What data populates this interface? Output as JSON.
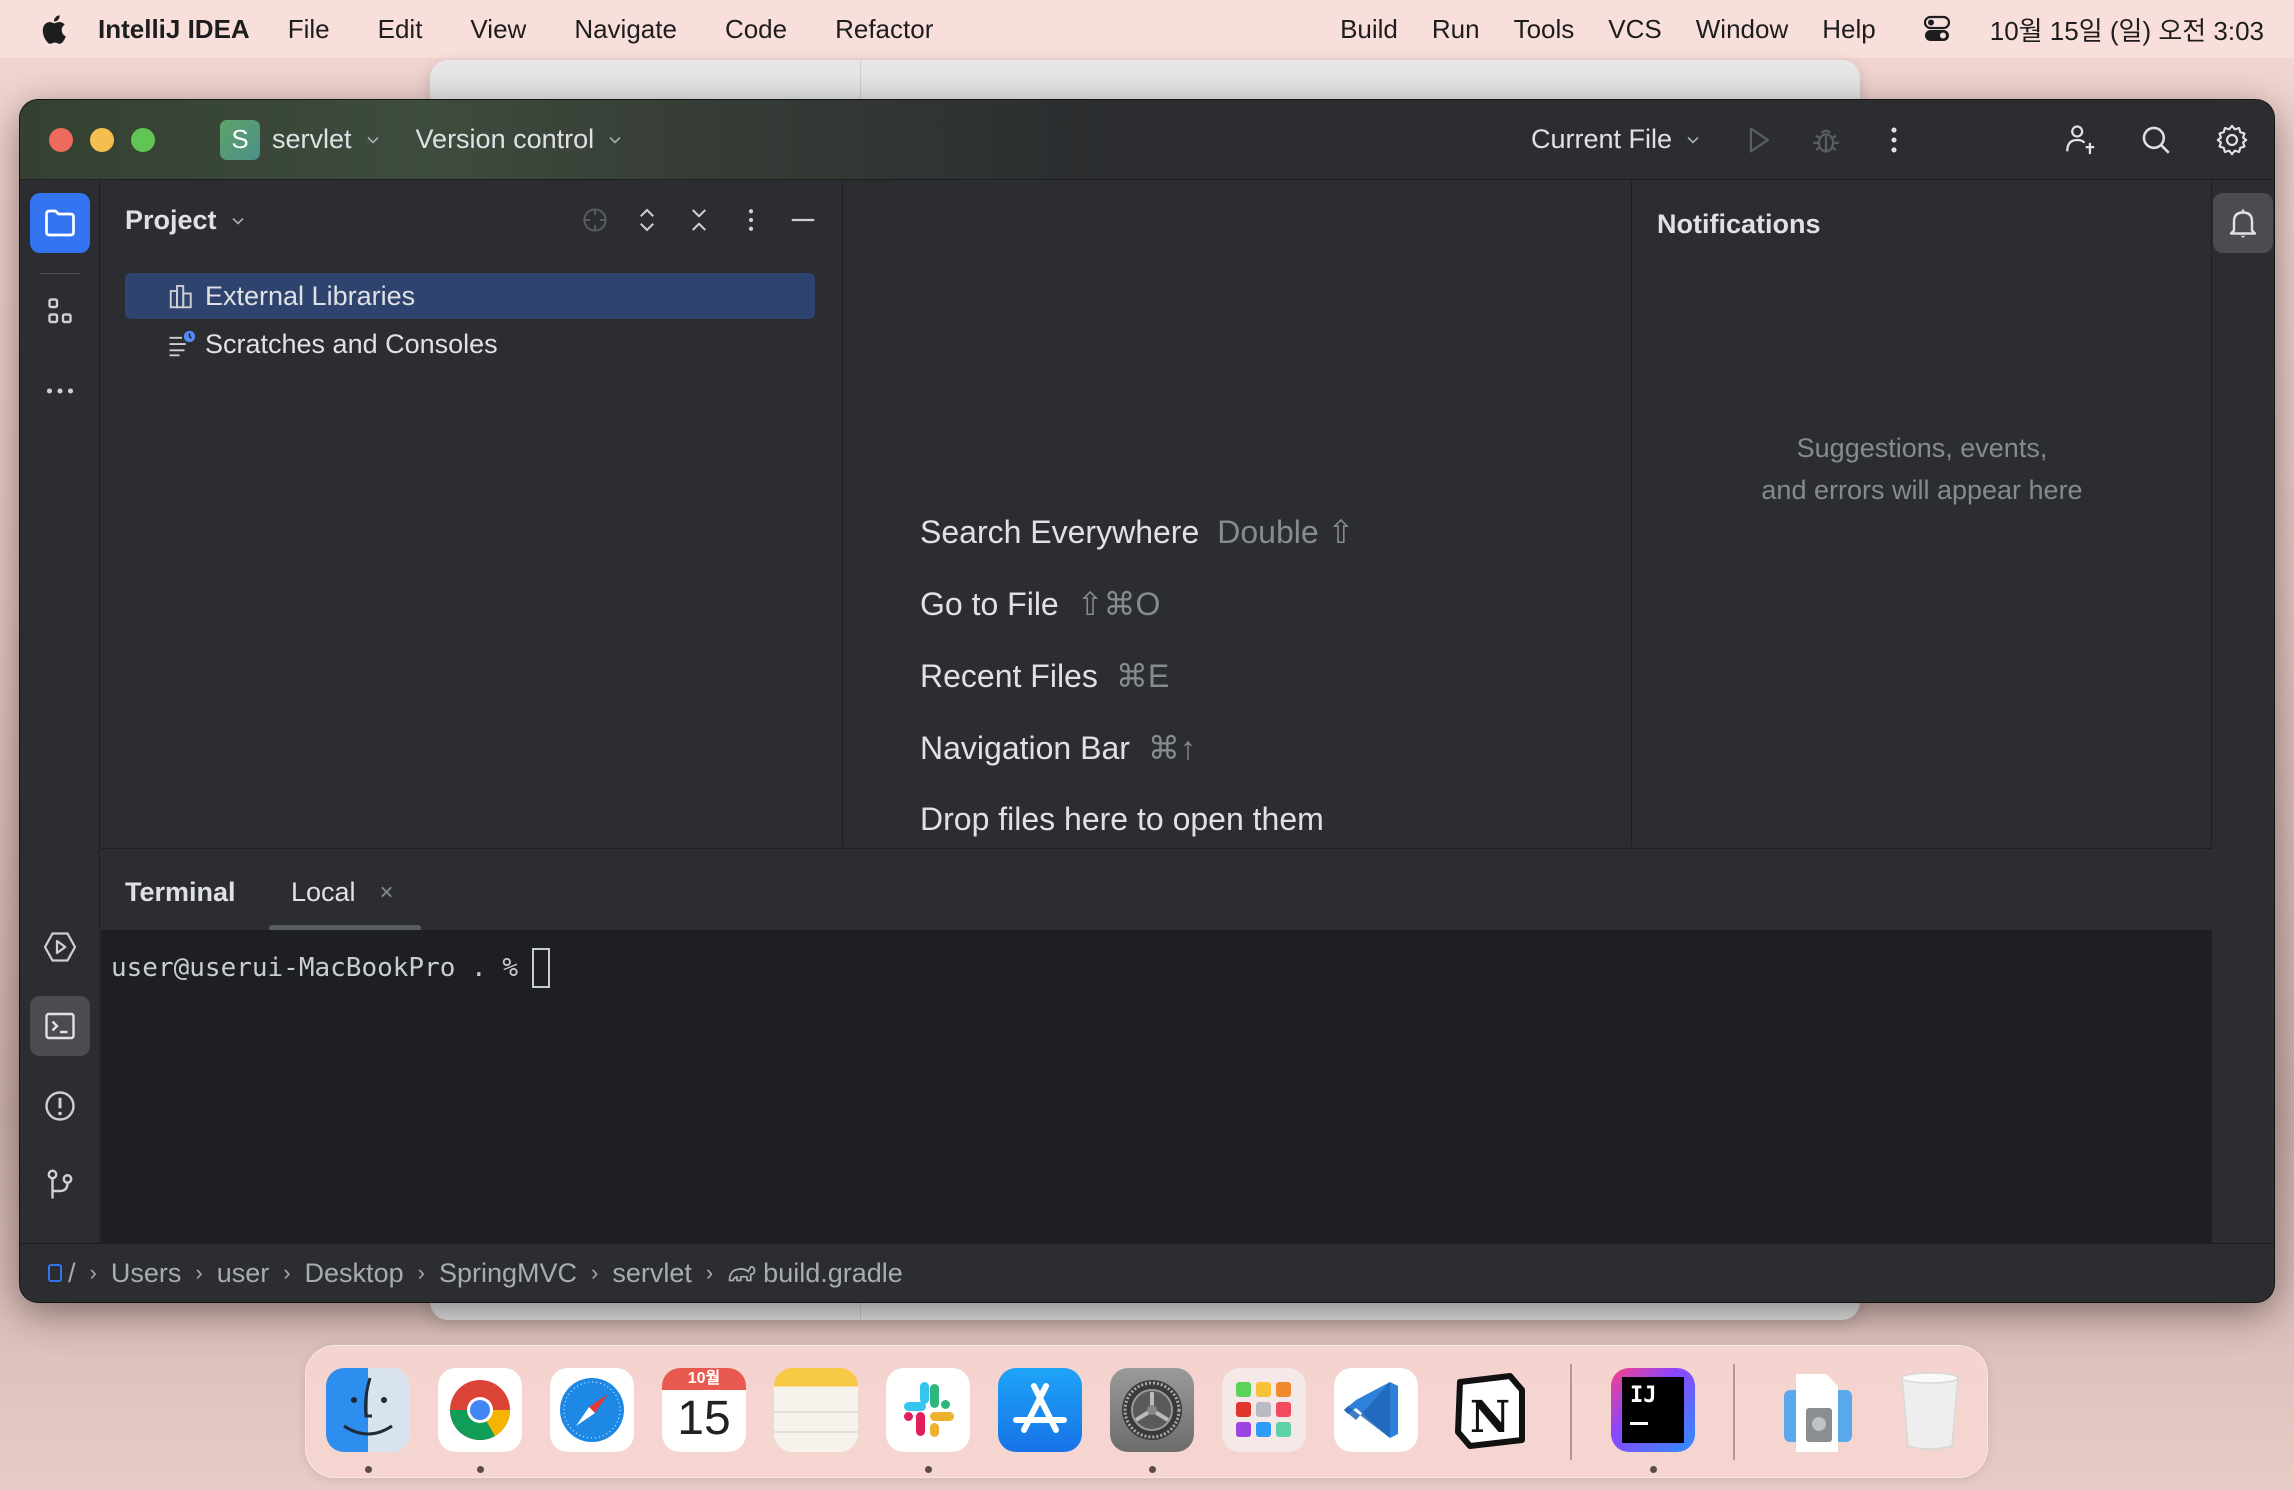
{
  "menubar": {
    "app_name": "IntelliJ IDEA",
    "items": [
      "File",
      "Edit",
      "View",
      "Navigate",
      "Code",
      "Refactor"
    ],
    "right_items": [
      "Build",
      "Run",
      "Tools",
      "VCS",
      "Window",
      "Help"
    ],
    "clock": "10월 15일 (일) 오전 3:03"
  },
  "titlebar": {
    "project_badge": "S",
    "project_name": "servlet",
    "vcs_label": "Version control",
    "run_config": "Current File"
  },
  "project_panel": {
    "title": "Project",
    "items": [
      {
        "label": "External Libraries",
        "selected": true
      },
      {
        "label": "Scratches and Consoles",
        "selected": false
      }
    ]
  },
  "editor": {
    "hints": [
      {
        "label": "Search Everywhere",
        "shortcut": "Double ⇧"
      },
      {
        "label": "Go to File",
        "shortcut": "⇧⌘O"
      },
      {
        "label": "Recent Files",
        "shortcut": "⌘E"
      },
      {
        "label": "Navigation Bar",
        "shortcut": "⌘↑"
      },
      {
        "label": "Drop files here to open them",
        "shortcut": ""
      }
    ]
  },
  "notifications": {
    "title": "Notifications",
    "empty_line1": "Suggestions, events,",
    "empty_line2": "and errors will appear here"
  },
  "terminal": {
    "title": "Terminal",
    "tab_label": "Local",
    "close_glyph": "×",
    "prompt": "user@userui-MacBookPro . %"
  },
  "breadcrumb": {
    "root": "/",
    "items": [
      "Users",
      "user",
      "Desktop",
      "SpringMVC",
      "servlet"
    ],
    "file": "build.gradle",
    "separator": "›"
  },
  "dock": {
    "calendar_month": "10월",
    "calendar_day": "15",
    "apps": [
      "Finder",
      "Chrome",
      "Safari",
      "Calendar",
      "Notes",
      "Slack",
      "App Store",
      "System Settings",
      "Launchpad",
      "VS Code",
      "Notion",
      "IntelliJ IDEA",
      "Downloads",
      "Trash"
    ],
    "jetbrains_label": "IJ"
  },
  "colors": {
    "accent": "#3574f0",
    "selection": "#2e436e",
    "panel_bg": "#2b2d30",
    "terminal_bg": "#1e1f22",
    "menubar_bg": "#f9dfdb"
  }
}
